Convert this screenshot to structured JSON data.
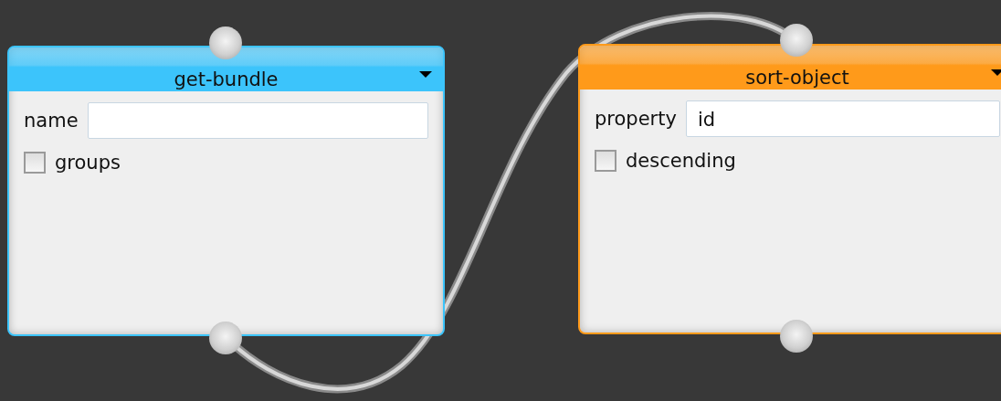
{
  "canvas": {
    "nodes": [
      {
        "title": "get-bundle",
        "color": "#3cc4fb",
        "fields": [
          {
            "kind": "text",
            "label": "name"
          },
          {
            "kind": "checkbox",
            "label": "groups",
            "checked": false
          }
        ]
      },
      {
        "title": "sort-object",
        "color": "#ff9a1a",
        "fields": [
          {
            "kind": "text",
            "label": "property",
            "value": "id"
          },
          {
            "kind": "checkbox",
            "label": "descending",
            "checked": false
          }
        ]
      }
    ]
  }
}
